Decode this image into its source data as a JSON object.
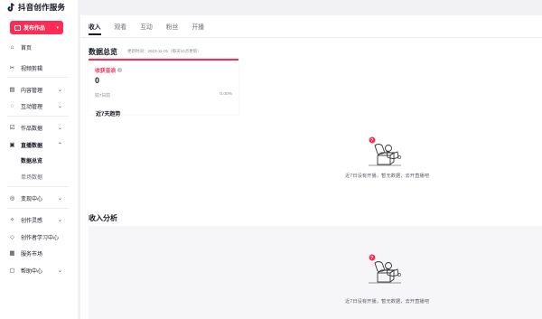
{
  "app": {
    "title": "抖音创作服务"
  },
  "sidebar": {
    "publish_label": "发布作品",
    "items": [
      {
        "label": "首页",
        "icon": "home-icon"
      },
      {
        "label": "视频剪辑",
        "icon": "scissors-icon"
      },
      {
        "label": "内容管理",
        "icon": "content-icon"
      },
      {
        "label": "互动管理",
        "icon": "chat-icon"
      },
      {
        "label": "作品数据",
        "icon": "data-icon"
      },
      {
        "label": "直播数据",
        "icon": "live-icon"
      },
      {
        "label": "数据总览"
      },
      {
        "label": "单场数据"
      },
      {
        "label": "变现中心",
        "icon": "money-icon"
      },
      {
        "label": "创作灵感",
        "icon": "bulb-icon"
      },
      {
        "label": "创作者学习中心",
        "icon": "study-icon"
      },
      {
        "label": "服务市场",
        "icon": "market-icon"
      },
      {
        "label": "帮助中心",
        "icon": "help-icon"
      }
    ]
  },
  "tabs": [
    {
      "label": "收入",
      "active": true
    },
    {
      "label": "观看"
    },
    {
      "label": "互动"
    },
    {
      "label": "粉丝"
    },
    {
      "label": "开播"
    }
  ],
  "overview": {
    "title": "数据总览",
    "update_note": "更新时间：2023-11-01（每天10点更新）",
    "card": {
      "title": "收获音浪",
      "value": "0",
      "sub_label": "较7日前",
      "change": "0.00%"
    }
  },
  "trend": {
    "title": "近7天趋势",
    "empty_text": "近7日没有开播，暂无数据，去开直播吧"
  },
  "analysis": {
    "title": "收入分析",
    "empty_text": "近7日没有开播，暂无数据，去开直播吧"
  },
  "colors": {
    "accent": "#fe2c55",
    "text": "#161823",
    "muted": "#8a8b91"
  }
}
